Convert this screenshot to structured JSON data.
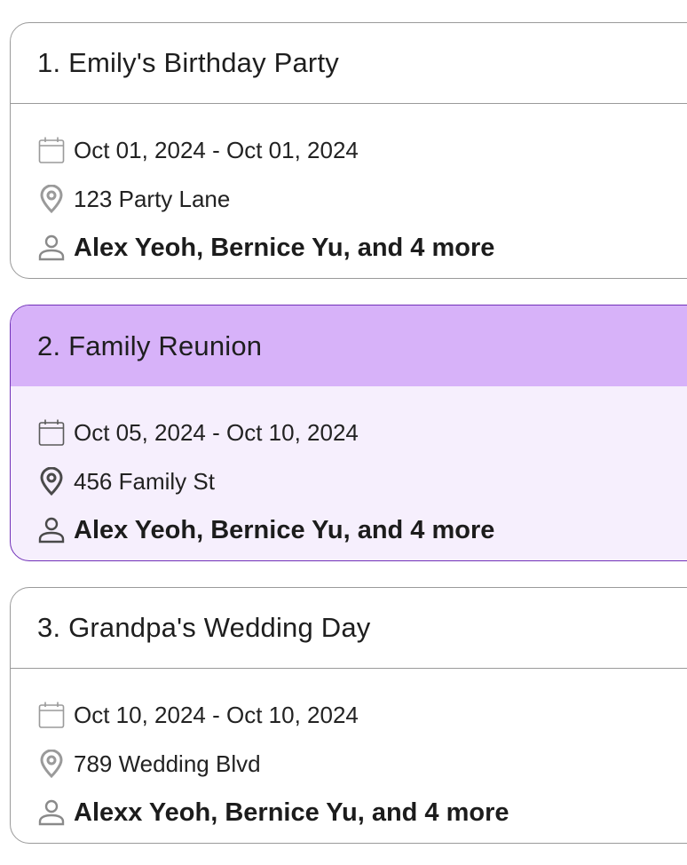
{
  "colors": {
    "selected_border": "#7030b8",
    "selected_header": "#d7b2f9",
    "selected_body": "#f6effd",
    "card_border": "#9a9a9a"
  },
  "events": [
    {
      "title": "1. Emily's Birthday Party",
      "date_range": "Oct 01, 2024 - Oct 01, 2024",
      "location": "123 Party Lane",
      "attendees": "Alex Yeoh, Bernice Yu, and 4 more",
      "selected": false
    },
    {
      "title": "2. Family Reunion",
      "date_range": "Oct 05, 2024 - Oct 10, 2024",
      "location": "456 Family St",
      "attendees": "Alex Yeoh, Bernice Yu, and 4 more",
      "selected": true
    },
    {
      "title": "3. Grandpa's Wedding Day",
      "date_range": "Oct 10, 2024 - Oct 10, 2024",
      "location": "789 Wedding Blvd",
      "attendees": "Alexx Yeoh, Bernice Yu, and 4 more",
      "selected": false
    }
  ],
  "icons": {
    "date": "calendar-icon",
    "location": "location-pin-icon",
    "attendees": "person-icon"
  }
}
